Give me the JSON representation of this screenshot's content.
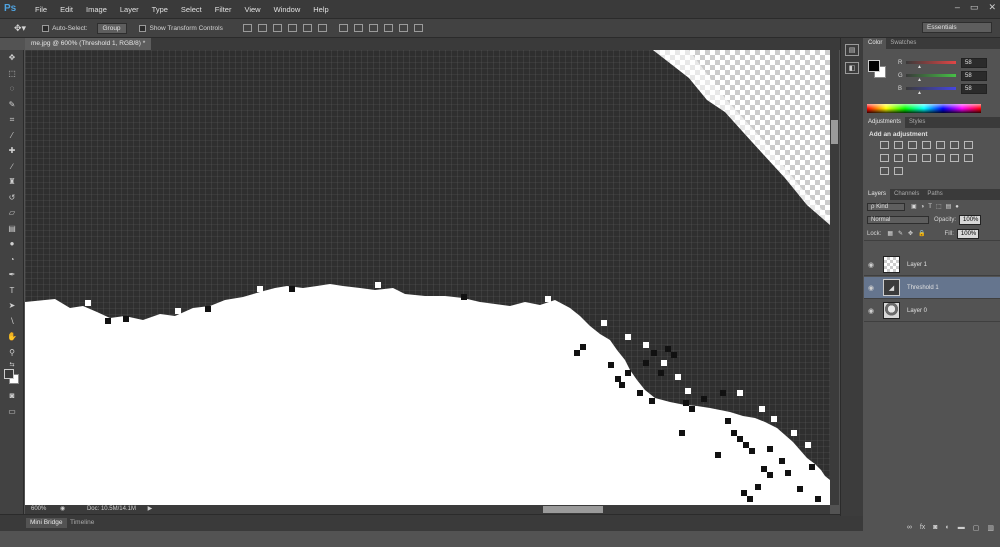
{
  "app": {
    "logo": "Ps"
  },
  "menu": [
    "File",
    "Edit",
    "Image",
    "Layer",
    "Type",
    "Select",
    "Filter",
    "View",
    "Window",
    "Help"
  ],
  "window_controls": {
    "minimize": "–",
    "restore": "▭",
    "close": "✕"
  },
  "options": {
    "auto_select_label": "Auto-Select:",
    "auto_select_value": "Group",
    "show_transform_label": "Show Transform Controls",
    "workspace": "Essentials"
  },
  "document": {
    "tab_title": "me.jpg @ 600% (Threshold 1, RGB/8) *"
  },
  "status": {
    "zoom": "600%",
    "doc_size": "Doc: 10.5M/14.1M"
  },
  "bottom_tabs": [
    "Mini Bridge",
    "Timeline"
  ],
  "color_panel": {
    "tabs": [
      "Color",
      "Swatches"
    ],
    "channels": [
      {
        "label": "R",
        "value": "58",
        "color": "#e04646"
      },
      {
        "label": "G",
        "value": "58",
        "color": "#46c046"
      },
      {
        "label": "B",
        "value": "58",
        "color": "#4646e0"
      }
    ],
    "foreground": "#000000",
    "background": "#ffffff"
  },
  "adjustments_panel": {
    "tabs": [
      "Adjustments",
      "Styles"
    ],
    "heading": "Add an adjustment"
  },
  "layers_panel": {
    "tabs": [
      "Layers",
      "Channels",
      "Paths"
    ],
    "filter_kind": "ρ Kind",
    "blend_mode": "Normal",
    "opacity_label": "Opacity:",
    "opacity_value": "100%",
    "lock_label": "Lock:",
    "fill_label": "Fill:",
    "fill_value": "100%",
    "layers": [
      {
        "name": "Layer 1",
        "selected": false
      },
      {
        "name": "Threshold 1",
        "selected": true
      },
      {
        "name": "Layer 0",
        "selected": false
      }
    ],
    "footer_icons": [
      "link-icon",
      "fx-icon",
      "mask-icon",
      "adjustment-icon",
      "folder-icon",
      "new-layer-icon",
      "trash-icon"
    ]
  }
}
